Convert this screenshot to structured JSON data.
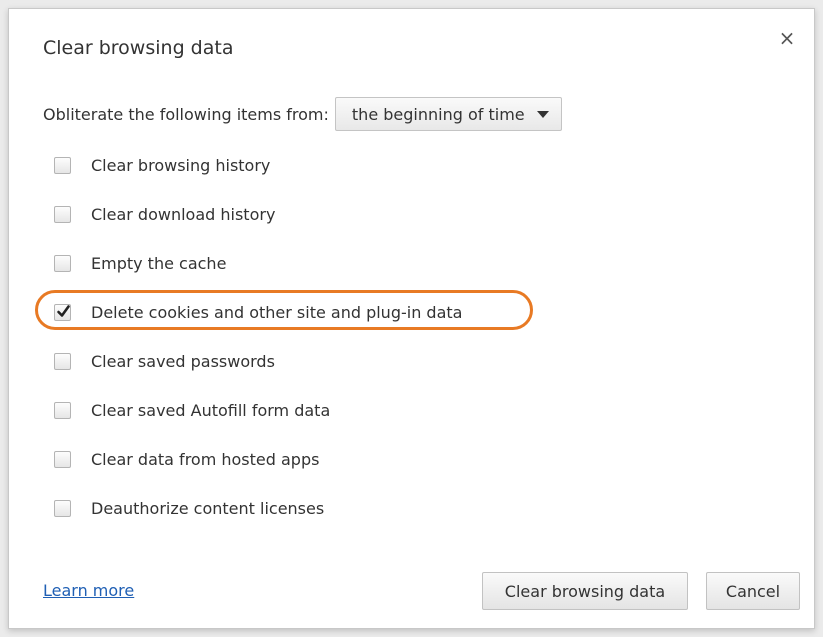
{
  "dialog": {
    "title": "Clear browsing data",
    "close_symbol": "×"
  },
  "obliterate": {
    "label": "Obliterate the following items from:",
    "selected": "the beginning of time"
  },
  "options": [
    {
      "label": "Clear browsing history",
      "checked": false
    },
    {
      "label": "Clear download history",
      "checked": false
    },
    {
      "label": "Empty the cache",
      "checked": false
    },
    {
      "label": "Delete cookies and other site and plug-in data",
      "checked": true
    },
    {
      "label": "Clear saved passwords",
      "checked": false
    },
    {
      "label": "Clear saved Autofill form data",
      "checked": false
    },
    {
      "label": "Clear data from hosted apps",
      "checked": false
    },
    {
      "label": "Deauthorize content licenses",
      "checked": false
    }
  ],
  "footer": {
    "learn_more": "Learn more",
    "clear_button": "Clear browsing data",
    "cancel_button": "Cancel"
  },
  "colors": {
    "highlight": "#e87a24",
    "link": "#1f5fb4"
  }
}
